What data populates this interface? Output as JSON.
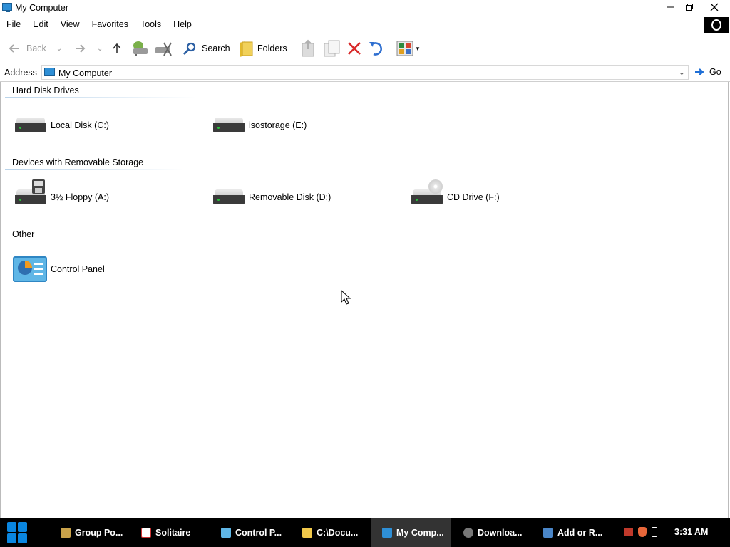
{
  "window": {
    "title": "My Computer"
  },
  "menu": [
    "File",
    "Edit",
    "View",
    "Favorites",
    "Tools",
    "Help"
  ],
  "toolbar": {
    "back": "Back",
    "search": "Search",
    "folders": "Folders"
  },
  "address": {
    "label": "Address",
    "value": "My Computer",
    "go": "Go"
  },
  "groups": [
    {
      "title": "Hard Disk Drives",
      "items": [
        {
          "label": "Local Disk (C:)",
          "icon": "hard-drive-icon"
        },
        {
          "label": "isostorage (E:)",
          "icon": "hard-drive-icon"
        }
      ]
    },
    {
      "title": "Devices with Removable Storage",
      "items": [
        {
          "label": "3½ Floppy (A:)",
          "icon": "floppy-drive-icon"
        },
        {
          "label": "Removable Disk (D:)",
          "icon": "removable-drive-icon"
        },
        {
          "label": "CD Drive (F:)",
          "icon": "cd-drive-icon"
        }
      ]
    },
    {
      "title": "Other",
      "items": [
        {
          "label": "Control Panel",
          "icon": "control-panel-icon"
        }
      ]
    }
  ],
  "taskbar": {
    "tasks": [
      {
        "label": "Group Po...",
        "icon": "group-policy-icon"
      },
      {
        "label": "Solitaire",
        "icon": "solitaire-icon"
      },
      {
        "label": "Control P...",
        "icon": "control-panel-icon"
      },
      {
        "label": "C:\\Docu...",
        "icon": "folder-icon"
      },
      {
        "label": "My Comp...",
        "icon": "computer-icon",
        "active": true
      },
      {
        "label": "Downloa...",
        "icon": "download-icon"
      },
      {
        "label": "Add or R...",
        "icon": "add-remove-icon"
      }
    ],
    "clock": "3:31 AM"
  },
  "colors": {
    "accent": "#0a86e0",
    "taskbar": "#000000",
    "active_task": "#333333"
  }
}
